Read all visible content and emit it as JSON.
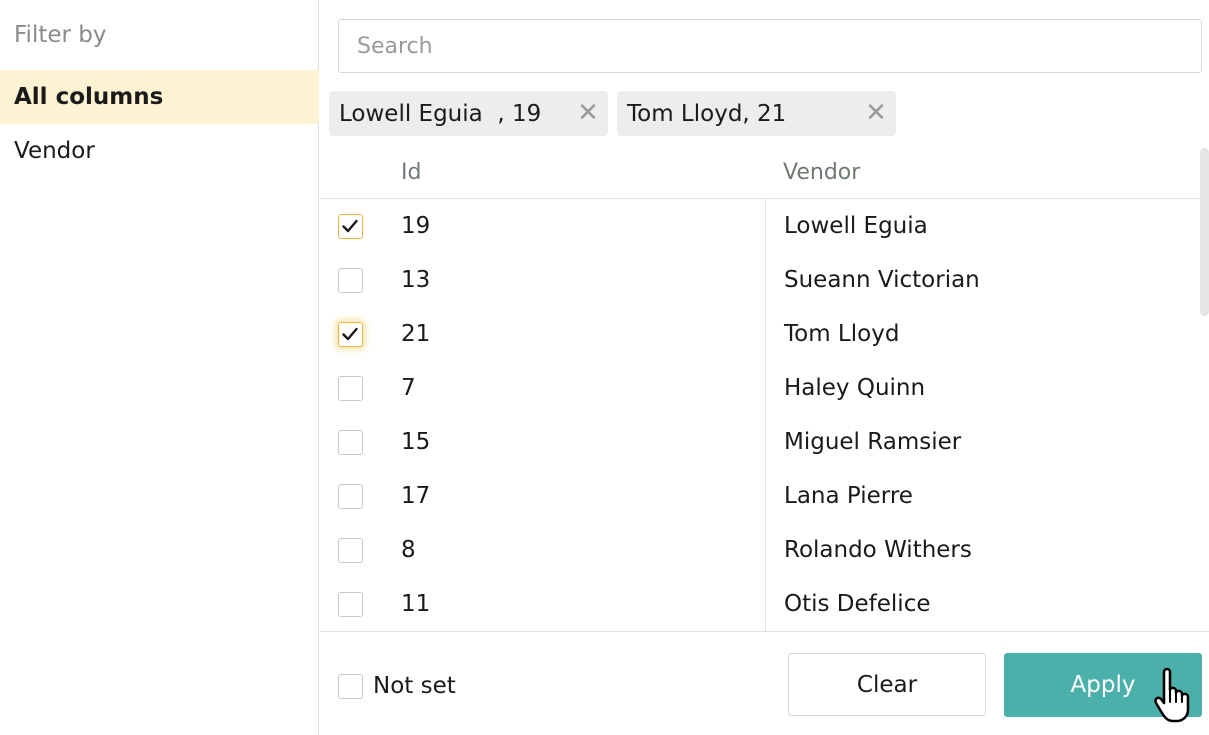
{
  "sidebar": {
    "title": "Filter by",
    "items": [
      {
        "label": "All columns",
        "active": true
      },
      {
        "label": "Vendor",
        "active": false
      }
    ]
  },
  "search": {
    "placeholder": "Search",
    "value": ""
  },
  "chips": [
    {
      "label": "Lowell Eguia  , 19"
    },
    {
      "label": "Tom Lloyd, 21"
    }
  ],
  "table": {
    "columns": [
      "Id",
      "Vendor"
    ],
    "rows": [
      {
        "id": "19",
        "vendor": "Lowell Eguia",
        "checked": true
      },
      {
        "id": "13",
        "vendor": "Sueann Victorian",
        "checked": false
      },
      {
        "id": "21",
        "vendor": "Tom Lloyd",
        "checked": true
      },
      {
        "id": "7",
        "vendor": "Haley Quinn",
        "checked": false
      },
      {
        "id": "15",
        "vendor": "Miguel Ramsier",
        "checked": false
      },
      {
        "id": "17",
        "vendor": "Lana Pierre",
        "checked": false
      },
      {
        "id": "8",
        "vendor": "Rolando Withers",
        "checked": false
      },
      {
        "id": "11",
        "vendor": "Otis Defelice",
        "checked": false
      }
    ]
  },
  "footer": {
    "not_set_label": "Not set",
    "not_set_checked": false,
    "clear_label": "Clear",
    "apply_label": "Apply"
  },
  "icons": {
    "chip_close": "close-icon",
    "checkmark": "checkmark-icon",
    "cursor": "hand-pointer-icon"
  },
  "colors": {
    "accent": "#4cb0aa",
    "active_bg": "#fdf3d2",
    "checkbox_checked_border": "#e6b845"
  }
}
